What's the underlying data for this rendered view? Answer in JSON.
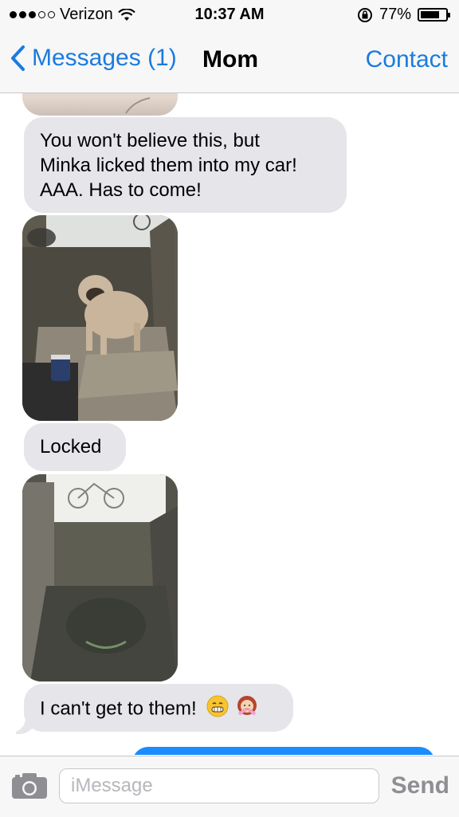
{
  "status_bar": {
    "carrier": "Verizon",
    "time": "10:37 AM",
    "battery_percent": "77%",
    "signal_bars_filled": 3,
    "battery_level": 0.77
  },
  "nav": {
    "back_label": "Messages (1)",
    "title": "Mom",
    "contact_label": "Contact"
  },
  "messages": [
    {
      "type": "text",
      "lines": [
        "You won't believe this, but",
        "Minka licked them into my car!",
        "AAA. Has to come!"
      ]
    },
    {
      "type": "photo",
      "icon": "pug-in-car-photo"
    },
    {
      "type": "text",
      "lines": [
        "Locked"
      ]
    },
    {
      "type": "photo",
      "icon": "dog-in-backseat-photo"
    },
    {
      "type": "text",
      "lines": [
        "I can't get to them!"
      ],
      "emojis": [
        "grimacing-face-emoji",
        "woman-no-gesture-emoji"
      ]
    }
  ],
  "input": {
    "placeholder": "iMessage",
    "send_label": "Send"
  },
  "colors": {
    "accent": "#1a7bdf",
    "received_bubble": "#e5e5ea",
    "sent_bubble": "#1a8cff",
    "bar_bg": "#f7f7f7"
  }
}
